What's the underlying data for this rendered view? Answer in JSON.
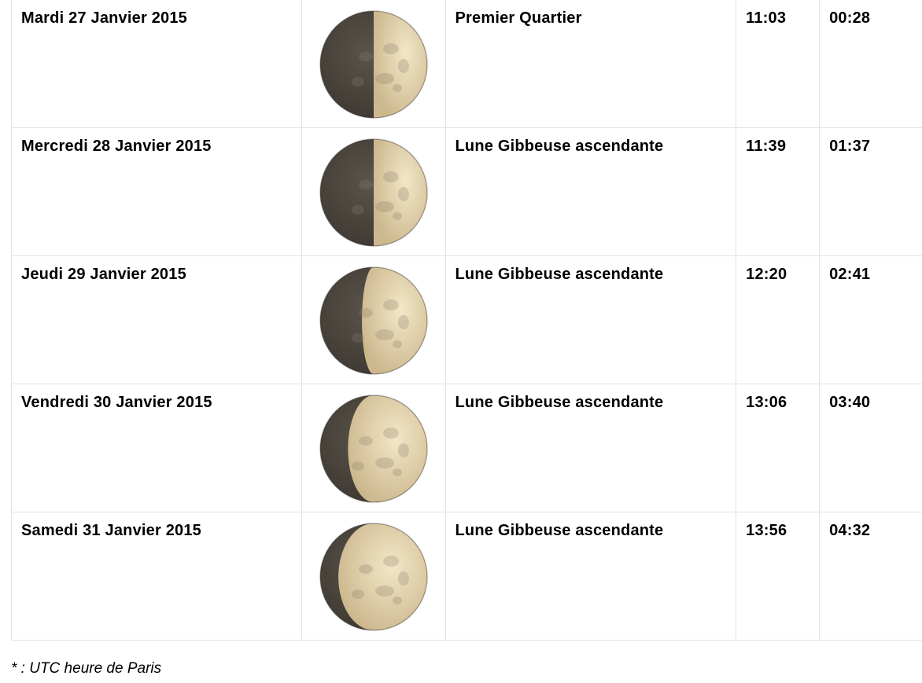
{
  "rows": [
    {
      "date": "Mardi 27 Janvier 2015",
      "phase": "Premier Quartier",
      "rise": "11:03",
      "set": "00:28",
      "illumination": 0.5
    },
    {
      "date": "Mercredi 28 Janvier 2015",
      "phase": "Lune Gibbeuse ascendante",
      "rise": "11:39",
      "set": "01:37",
      "illumination": 0.5
    },
    {
      "date": "Jeudi 29 Janvier 2015",
      "phase": "Lune Gibbeuse ascendante",
      "rise": "12:20",
      "set": "02:41",
      "illumination": 0.61
    },
    {
      "date": "Vendredi 30 Janvier 2015",
      "phase": "Lune Gibbeuse ascendante",
      "rise": "13:06",
      "set": "03:40",
      "illumination": 0.74
    },
    {
      "date": "Samedi 31 Janvier 2015",
      "phase": "Lune Gibbeuse ascendante",
      "rise": "13:56",
      "set": "04:32",
      "illumination": 0.83
    }
  ],
  "footnote": "* : UTC heure de Paris",
  "colors": {
    "moon_dark": "#3f3a33",
    "moon_lit": "#e8d8b4",
    "grid": "#e2e2e2"
  },
  "icon": "moon-phase-icon"
}
